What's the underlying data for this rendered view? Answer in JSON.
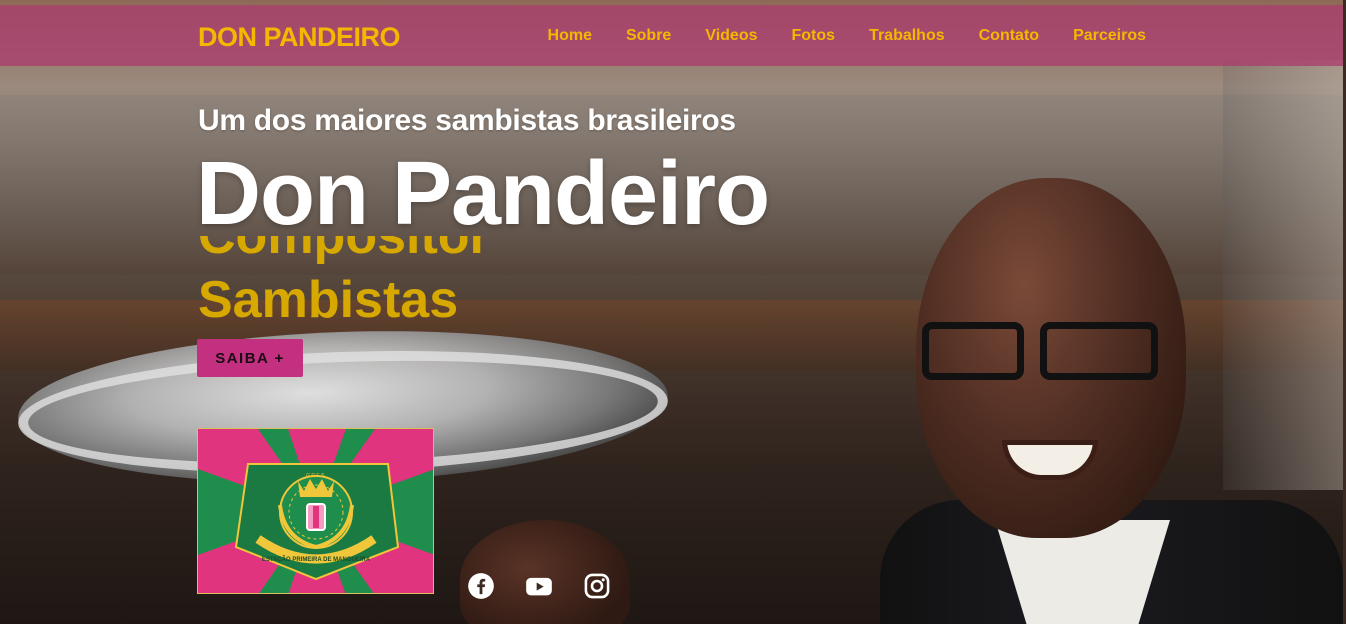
{
  "header": {
    "brand": "DON PANDEIRO",
    "nav": [
      "Home",
      "Sobre",
      "Videos",
      "Fotos",
      "Trabalhos",
      "Contato",
      "Parceiros"
    ]
  },
  "hero": {
    "subtitle": "Um dos maiores sambistas brasileiros",
    "title": "Don Pandeiro",
    "rotating_words": [
      "Compositor",
      "Sambistas"
    ],
    "cta_label": "SAIBA +"
  },
  "flag": {
    "motto_text": "ESTAÇÃO PRIMEIRA DE MANGUEIRA",
    "badge_text": "G.R.E.S."
  },
  "social": [
    "facebook-icon",
    "youtube-icon",
    "instagram-icon"
  ],
  "colors": {
    "accent": "#f5b700",
    "navbar": "#ab3e6e",
    "button": "#c2307f",
    "flag_green": "#1f8d4b",
    "flag_pink": "#e0347f"
  }
}
